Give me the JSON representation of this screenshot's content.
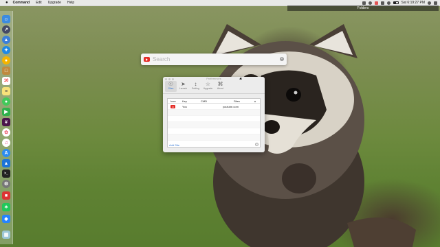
{
  "menubar": {
    "app_name": "Command",
    "items": [
      "Edit",
      "Upgrade",
      "Help"
    ],
    "clock": "Sat 6:19:27 PM",
    "folders_label": "Folders"
  },
  "search": {
    "placeholder": "Search",
    "value": ""
  },
  "preferences": {
    "title": "Preferences",
    "toolbar": [
      {
        "label": "Sites",
        "icon": "globe-icon",
        "active": true
      },
      {
        "label": "Launch",
        "icon": "rocket-icon",
        "active": false
      },
      {
        "label": "Setting",
        "icon": "sliders-icon",
        "active": false
      },
      {
        "label": "Upgrade",
        "icon": "star-icon",
        "active": false
      },
      {
        "label": "About",
        "icon": "command-icon",
        "active": false
      }
    ],
    "table": {
      "columns": [
        "Icon",
        "Key",
        "CMD",
        "Sites"
      ],
      "rows": [
        {
          "icon": "youtube-icon",
          "key": "You",
          "cmd": "",
          "site": "youtube.com"
        }
      ]
    },
    "add_site_label": "Add Site",
    "help_label": "?"
  },
  "colors": {
    "youtube_red": "#e52d27",
    "accent_blue": "#3a7bd5"
  },
  "dock": {
    "icons": [
      "finder-icon",
      "launchpad-icon",
      "rocket-icon",
      "safari-icon",
      "chrome-icon",
      "folder-icon",
      "calendar-icon",
      "notes-icon",
      "messages-icon",
      "facetime-icon",
      "slack-icon",
      "photos-icon",
      "itunes-icon",
      "app-store-icon",
      "preferences-icon",
      "terminal-icon",
      "settings-icon",
      "gift-icon",
      "robinhood-icon",
      "sourcetree-icon",
      "trash-icon"
    ]
  }
}
